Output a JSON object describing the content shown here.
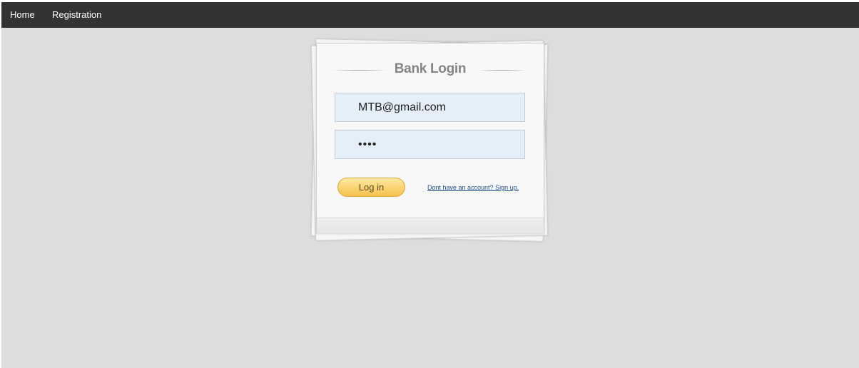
{
  "nav": {
    "items": [
      {
        "label": "Home"
      },
      {
        "label": "Registration"
      }
    ]
  },
  "login": {
    "title": "Bank Login",
    "email": {
      "value": "MTB@gmail.com"
    },
    "password": {
      "value": "••••"
    },
    "login_label": "Log in",
    "signup_label": "Dont have an account? Sign up."
  },
  "colors": {
    "navbar": "#333333",
    "background": "#dcdddf",
    "input_fill": "#e4eff9",
    "button_gold": "#f7c24e",
    "link": "#1f4f8a"
  }
}
